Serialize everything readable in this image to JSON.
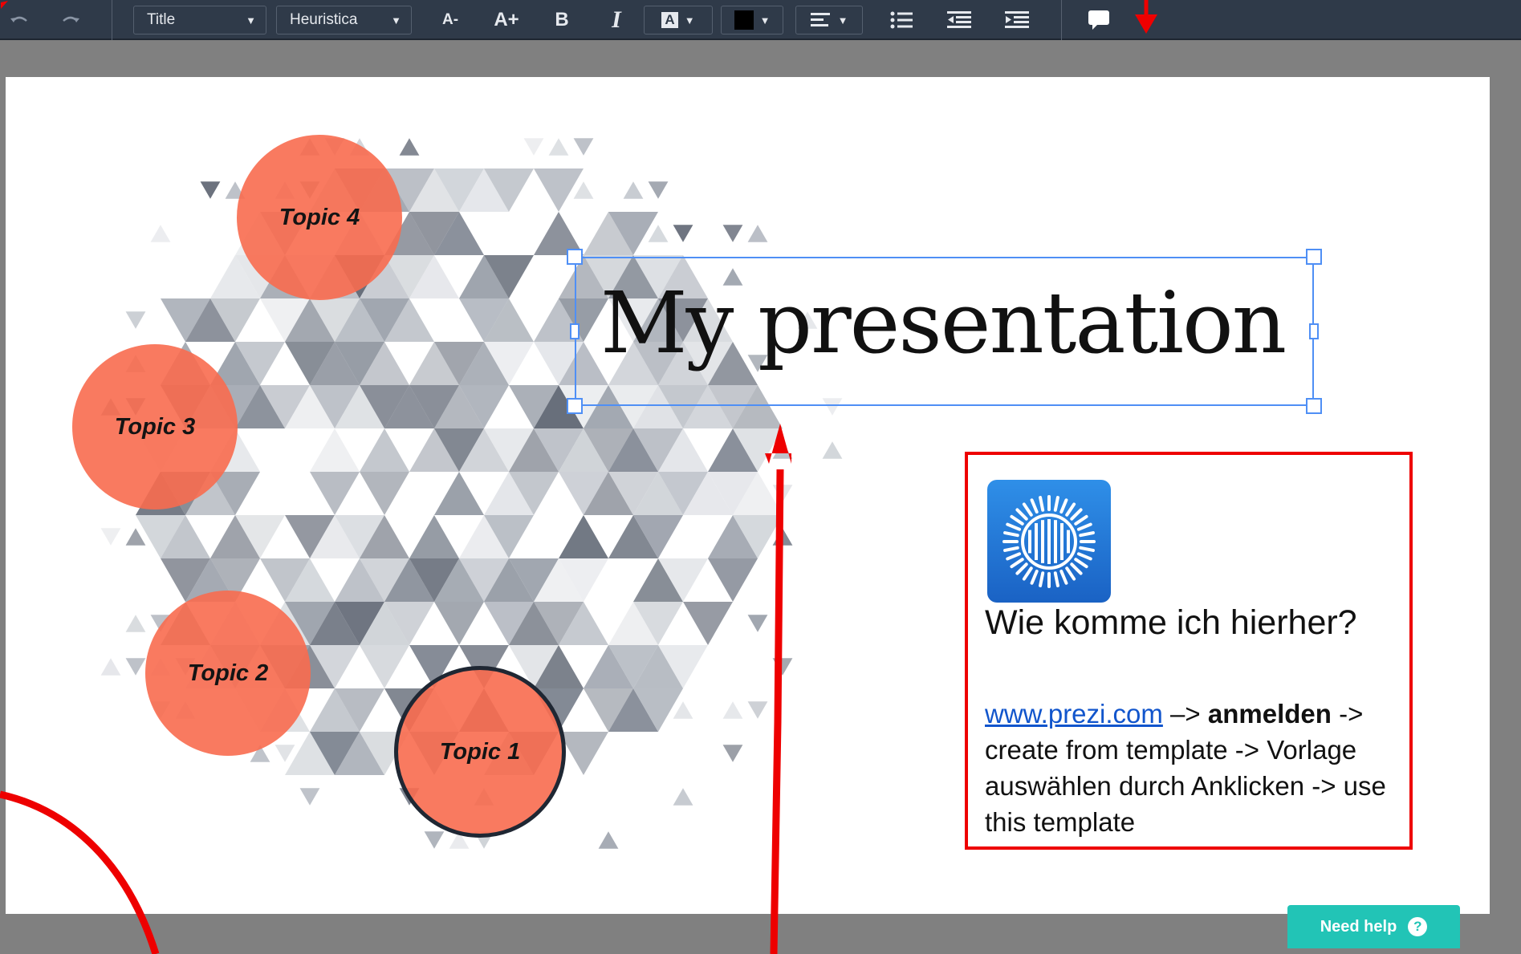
{
  "toolbar": {
    "style_select": "Title",
    "font_select": "Heuristica",
    "decrease_font": "A-",
    "increase_font": "A+",
    "bold": "B",
    "italic": "I",
    "highlight": "A"
  },
  "slide": {
    "title": "My presentation",
    "topics": [
      "Topic 1",
      "Topic 2",
      "Topic 3",
      "Topic 4"
    ]
  },
  "info_box": {
    "question": "Wie komme ich hierher?",
    "link": "www.prezi.com",
    "arrow1": " –> ",
    "bold_step": "anmelden",
    "rest": " -> create from template -> Vorlage auswählen durch Anklicken -> use this template"
  },
  "help": {
    "label": "Need help",
    "icon": "?"
  },
  "icons": {
    "undo": "undo-icon",
    "redo": "redo-icon",
    "list": "bulleted-list-icon",
    "outdent": "outdent-icon",
    "indent": "indent-icon",
    "comment": "comment-icon",
    "align": "align-left-icon",
    "prezi": "prezi-logo-icon"
  },
  "colors": {
    "toolbar_bg": "#2f3a49",
    "topic_fill": "#f86c4f",
    "selection": "#4f8ff5",
    "annotation_red": "#ee0000",
    "help_button": "#22c4b6"
  }
}
